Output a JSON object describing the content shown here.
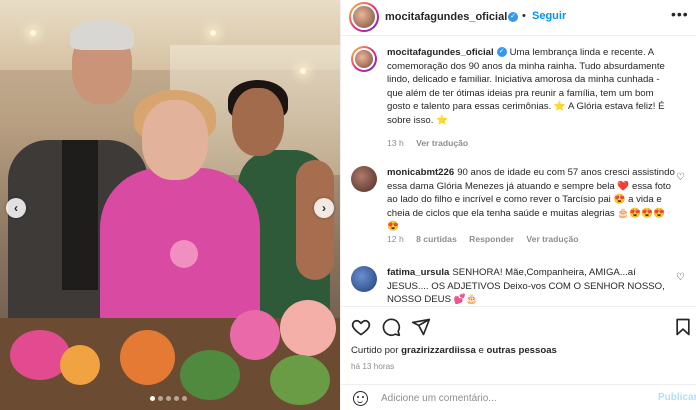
{
  "post": {
    "username": "mocitafagundes_oficial",
    "separator": "•",
    "follow_label": "Seguir",
    "more_label": "•••"
  },
  "caption": {
    "username": "mocitafagundes_oficial",
    "text": "Uma lembrança linda e recente. A comemoração dos 90 anos da minha rainha. Tudo absurdamente lindo, delicado e familiar. Iniciativa amorosa da minha cunhada - que além de ter ótimas ideias pra reunir a família, tem um bom gosto e talento para essas cerimônias. ⭐ A Glória estava feliz! É sobre isso. ⭐",
    "time": "13 h",
    "translation_label": "Ver tradução"
  },
  "comments": [
    {
      "username": "monicabmt226",
      "text": "90 anos de idade eu com 57 anos cresci assistindo essa dama Glória Menezes já atuando e sempre bela ❤️ essa foto ao lado do filho e incrível e como rever o Tarcísio pai 😍 a vida e cheia de ciclos que ela tenha saúde e muitas alegrias 🎂😍😍😍😍",
      "time": "12 h",
      "likes": "8 curtidas",
      "reply_label": "Responder",
      "translation_label": "Ver tradução"
    },
    {
      "username": "fatima_ursula",
      "text": "SENHORA! Mãe,Companheira, AMIGA...aí JESUS.... OS ADJETIVOS Deixo-vos COM O SENHOR NOSSO, NOSSO DEUS 💕🎂"
    }
  ],
  "liked_by": {
    "prefix": "Curtido por",
    "user": "grazirizzardiissa",
    "suffix": "e",
    "others": "outras pessoas"
  },
  "posted_time": "há 13 horas",
  "comment_input": {
    "placeholder": "Adicione um comentário...",
    "publish_label": "Publicar"
  },
  "icons": {
    "verified": "verified-badge-icon",
    "like": "heart-icon",
    "comment": "comment-icon",
    "share": "share-icon",
    "save": "bookmark-icon",
    "emoji": "emoji-icon"
  },
  "colors": {
    "link_blue": "#0095f6",
    "verified_blue": "#3897f0",
    "secondary_text": "#8e8e8e",
    "publish_disabled": "#b2dffc"
  },
  "carousel": {
    "prev_label": "‹",
    "next_label": "›",
    "slide_count": 5,
    "active_slide": 1
  }
}
